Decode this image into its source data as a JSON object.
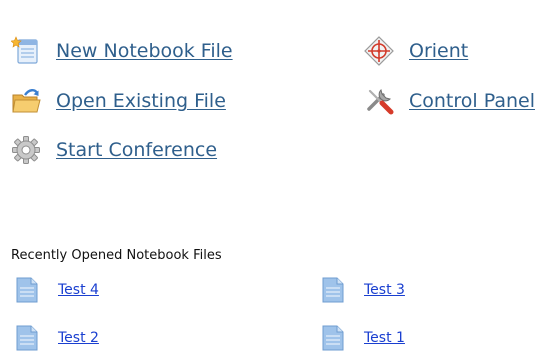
{
  "actions": {
    "new_notebook": {
      "label": "New Notebook File",
      "icon": "new-document-icon"
    },
    "open_existing": {
      "label": "Open Existing File",
      "icon": "open-folder-icon"
    },
    "start_conference": {
      "label": "Start Conference",
      "icon": "gear-icon"
    },
    "orient": {
      "label": "Orient",
      "icon": "orient-crosshair-icon"
    },
    "control_panel": {
      "label": "Control Panel",
      "icon": "tools-icon"
    }
  },
  "recent": {
    "title": "Recently Opened Notebook Files",
    "files": [
      {
        "label": "Test 4"
      },
      {
        "label": "Test 3"
      },
      {
        "label": "Test 2"
      },
      {
        "label": "Test 1"
      }
    ]
  },
  "colors": {
    "action_link": "#2f5f8c",
    "recent_link": "#1a3fd0",
    "doc_icon": "#7fa9d9"
  }
}
